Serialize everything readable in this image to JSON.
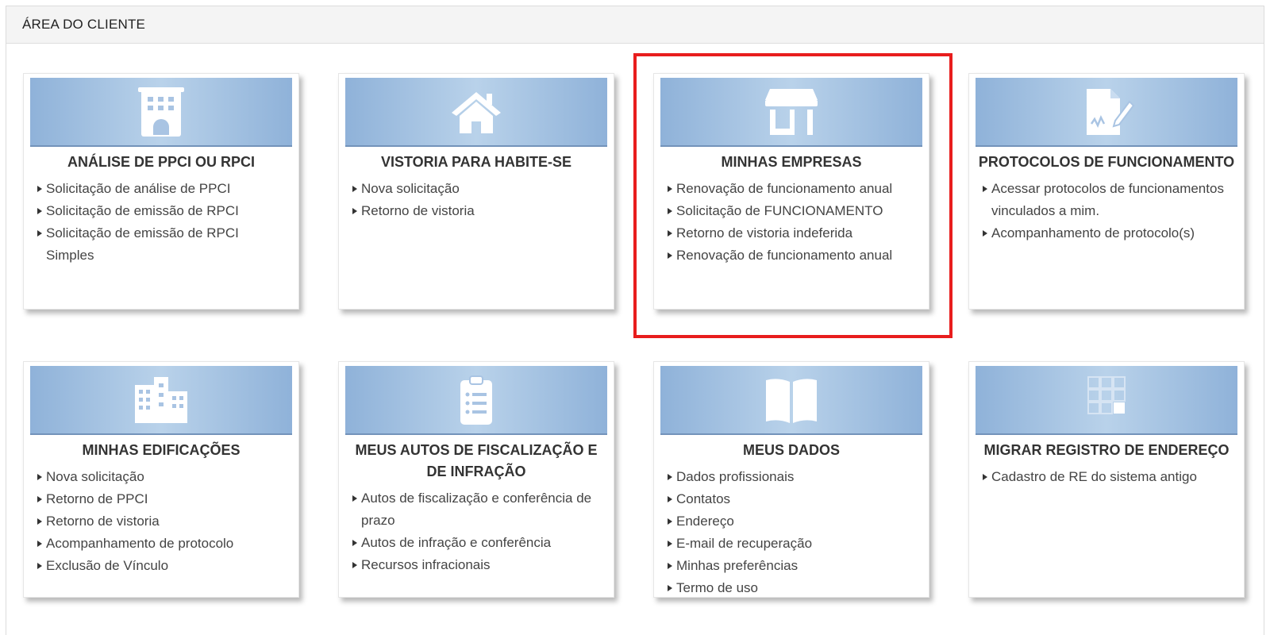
{
  "panel": {
    "title": "ÁREA DO CLIENTE"
  },
  "cards": [
    {
      "icon": "building-icon",
      "title": "ANÁLISE DE PPCI OU RPCI",
      "links": [
        "Solicitação de análise de PPCI",
        "Solicitação de emissão de RPCI",
        "Solicitação de emissão de RPCI Simples"
      ]
    },
    {
      "icon": "house-icon",
      "title": "VISTORIA PARA HABITE-SE",
      "links": [
        "Nova solicitação",
        "Retorno de vistoria"
      ]
    },
    {
      "icon": "storefront-icon",
      "title": "MINHAS EMPRESAS",
      "links": [
        "Renovação de funcionamento anual",
        "Solicitação de FUNCIONAMENTO",
        "Retorno de vistoria indeferida",
        "Renovação de funcionamento anual"
      ]
    },
    {
      "icon": "document-signature-icon",
      "title": "PROTOCOLOS DE FUNCIONAMENTO",
      "links": [
        "Acessar protocolos de funcionamentos vinculados a mim.",
        "Acompanhamento de protocolo(s)"
      ]
    },
    {
      "icon": "city-buildings-icon",
      "title": "MINHAS EDIFICAÇÕES",
      "links": [
        "Nova solicitação",
        "Retorno de PPCI",
        "Retorno de vistoria",
        "Acompanhamento de protocolo",
        "Exclusão de Vínculo"
      ]
    },
    {
      "icon": "clipboard-list-icon",
      "title": "MEUS AUTOS DE FISCALIZAÇÃO E DE INFRAÇÃO",
      "links": [
        "Autos de fiscalização e conferência de prazo",
        "Autos de infração e conferência",
        "Recursos infracionais"
      ]
    },
    {
      "icon": "open-book-icon",
      "title": "MEUS DADOS",
      "links": [
        "Dados profissionais",
        "Contatos",
        "Endereço",
        "E-mail de recuperação",
        "Minhas preferências",
        "Termo de uso"
      ]
    },
    {
      "icon": "grid-squares-icon",
      "title": "MIGRAR REGISTRO DE ENDEREÇO",
      "links": [
        "Cadastro de RE do sistema antigo"
      ]
    }
  ],
  "highlight_color": "#e81d1d",
  "banner_colors": [
    "#8fb2d9",
    "#b9d2ea"
  ]
}
